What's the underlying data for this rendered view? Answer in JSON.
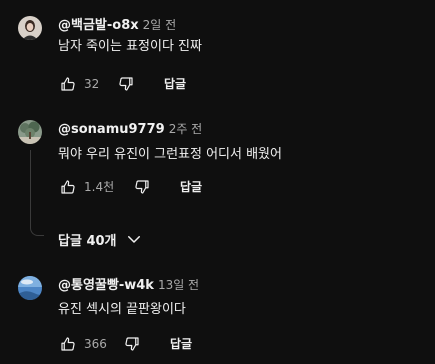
{
  "comments": [
    {
      "author": "@백금발-o8x",
      "time": "2일 전",
      "text": "남자 죽이는 표정이다 진짜",
      "likes": "32",
      "reply_label": "답글"
    },
    {
      "author": "@sonamu9779",
      "time": "2주 전",
      "text": "뭐야 우리 유진이 그런표정 어디서 배웠어",
      "likes": "1.4천",
      "reply_label": "답글",
      "replies_toggle": "답글 40개"
    },
    {
      "author": "@통영꿀빵-w4k",
      "time": "13일 전",
      "text": "유진 섹시의 끝판왕이다",
      "likes": "366",
      "reply_label": "답글"
    }
  ],
  "icons": {
    "like": "thumbs-up-icon",
    "dislike": "thumbs-down-icon",
    "expand": "chevron-down-icon"
  },
  "colors": {
    "background": "#0f0f0f",
    "text": "#f1f1f1",
    "secondary": "#aaaaaa"
  }
}
